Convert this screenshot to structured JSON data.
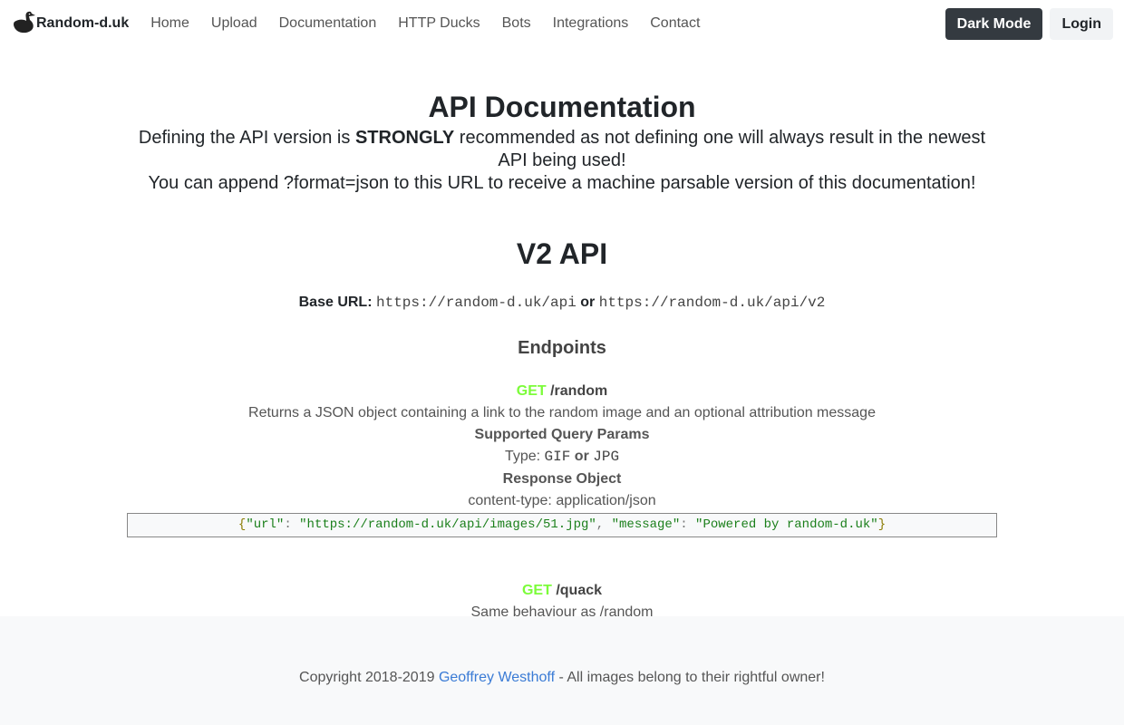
{
  "nav": {
    "brand": "Random-d.uk",
    "links": [
      "Home",
      "Upload",
      "Documentation",
      "HTTP Ducks",
      "Bots",
      "Integrations",
      "Contact"
    ],
    "dark_mode": "Dark Mode",
    "login": "Login"
  },
  "page": {
    "title": "API Documentation",
    "intro_pre": "Defining the API version is",
    "intro_strong": "STRONGLY",
    "intro_post": "recommended as not defining one will always result in the newest API being used!",
    "intro_line2": "You can append ?format=json to this URL to receive a machine parsable version of this documentation!"
  },
  "v2": {
    "title": "V2 API",
    "base_label": "Base URL:",
    "base_url_1": "https://random-d.uk/api",
    "or": "or",
    "base_url_2": "https://random-d.uk/api/v2",
    "endpoints_title": "Endpoints",
    "endpoints": [
      {
        "method": "GET",
        "path": "/random",
        "description": "Returns a JSON object containing a link to the random image and an optional attribution message",
        "params_title": "Supported Query Params",
        "type_label": "Type:",
        "type_a": "GIF",
        "type_or": "or",
        "type_b": "JPG",
        "response_title": "Response Object",
        "content_type": "content-type: application/json",
        "json": {
          "key1": "\"url\"",
          "val1": "\"https://random-d.uk/api/images/51.jpg\"",
          "key2": "\"message\"",
          "val2": "\"Powered by random-d.uk\""
        }
      },
      {
        "method": "GET",
        "path": "/quack",
        "description": "Same behaviour as /random"
      }
    ]
  },
  "footer": {
    "prefix": "Copyright 2018-2019",
    "author": "Geoffrey Westhoff",
    "suffix": "- All images belong to their rightful owner!"
  },
  "colors": {
    "method_get": "#7cfc3a",
    "link": "#3a7bd5",
    "dark_button": "#343a40"
  }
}
